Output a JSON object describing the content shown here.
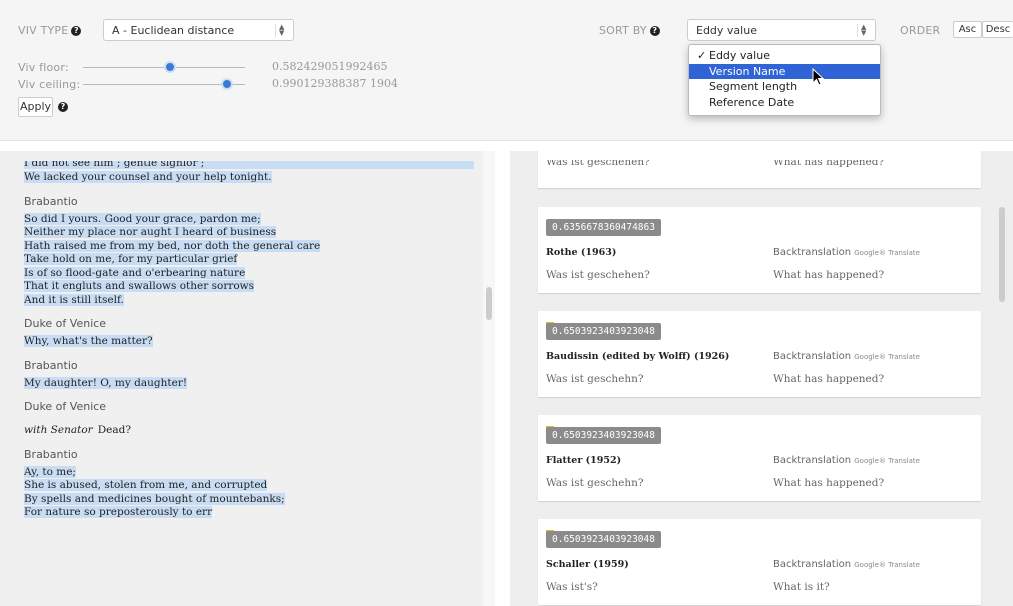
{
  "controls": {
    "viv_type_label": "VIV TYPE",
    "viv_type_value": "A - Euclidean distance",
    "viv_floor_label": "Viv floor:",
    "viv_floor_value": "0.582429051992465",
    "viv_ceiling_label": "Viv ceiling:",
    "viv_ceiling_value": "0.990129388387 1904",
    "apply_label": "Apply",
    "sort_by_label": "SORT BY",
    "sort_by_value": "Eddy value",
    "order_label": "ORDER",
    "asc_label": "Asc",
    "desc_label": "Desc",
    "help_glyph": "?"
  },
  "sort_menu": {
    "check_glyph": "✓",
    "items": [
      "Eddy value",
      "Version Name",
      "Segment length",
      "Reference Date"
    ]
  },
  "script": {
    "partial_top": "I did not see him ; gentle signior ;",
    "blocks": [
      {
        "speaker": "",
        "lines": [
          "We lacked your counsel and your help tonight."
        ]
      },
      {
        "speaker": "Brabantio",
        "lines": [
          "So did I yours. Good your grace, pardon me;",
          "Neither my place nor aught I heard of business",
          "Hath raised me from my bed, nor doth the general care",
          "Take hold on me, for my particular grief",
          "Is of so flood-gate and o'erbearing nature",
          "That it engluts and swallows other sorrows",
          "And it is still itself."
        ]
      },
      {
        "speaker": "Duke of Venice",
        "lines": [
          "Why, what's the matter?"
        ]
      },
      {
        "speaker": "Brabantio",
        "lines": [
          "My daughter! O, my daughter!"
        ]
      },
      {
        "speaker": "Duke of Venice",
        "stage": "with Senator",
        "lines": [
          "Dead?"
        ]
      },
      {
        "speaker": "Brabantio",
        "lines": [
          "Ay, to me;",
          "She is abused, stolen from me, and corrupted",
          "By spells and medicines bought of mountebanks;",
          "For nature so preposterously to err"
        ]
      }
    ]
  },
  "cards": {
    "backtranslation_label": "Backtranslation",
    "google_label": "Google® Translate",
    "partial_top": {
      "german": "Was ist geschehen?",
      "english": "What has happened?"
    },
    "items": [
      {
        "value": "0.6356678360474863",
        "version": "Rothe (1963)",
        "german": "Was ist geschehen?",
        "english": "What has happened?"
      },
      {
        "value": "0.6503923403923048",
        "version": "Baudissin (edited by Wolff) (1926)",
        "german": "Was ist geschehn?",
        "english": "What has happened?"
      },
      {
        "value": "0.6503923403923048",
        "version": "Flatter (1952)",
        "german": "Was ist geschehn?",
        "english": "What has happened?"
      },
      {
        "value": "0.6503923403923048",
        "version": "Schaller (1959)",
        "german": "Was ist's?",
        "english": "What is it?"
      }
    ]
  },
  "colors": {
    "accent": "#2f63d6",
    "highlight": "#c8ddf4",
    "badge": "#8b8b8b",
    "flag": "#f2b233"
  }
}
